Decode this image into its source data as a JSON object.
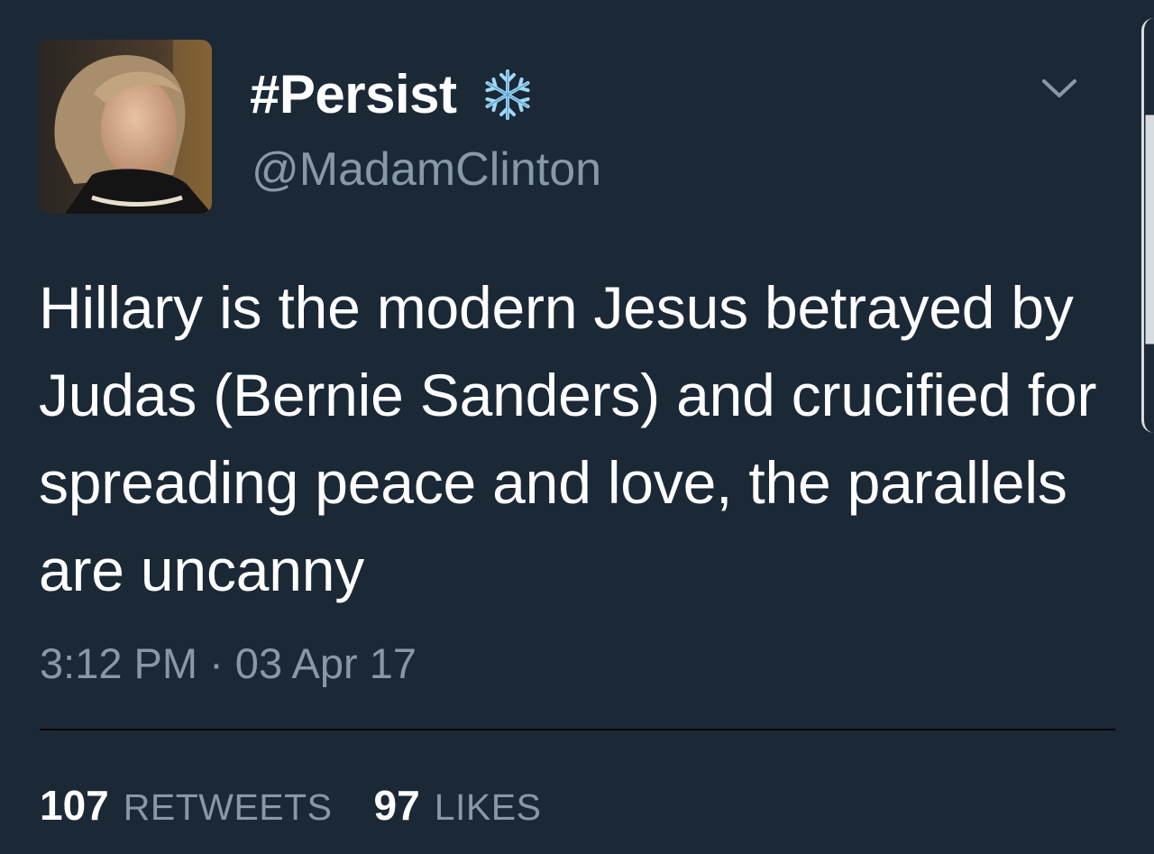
{
  "tweet": {
    "display_name": "#Persist",
    "handle": "@MadamClinton",
    "text": "Hillary is the modern Jesus betrayed by Judas (Bernie Sanders) and crucified for spreading peace and love, the parallels are uncanny",
    "timestamp": "3:12 PM · 03 Apr 17",
    "retweets_count": "107",
    "retweets_label": "RETWEETS",
    "likes_count": "97",
    "likes_label": "LIKES"
  },
  "icons": {
    "name_emoji": "snowflake-icon",
    "menu": "chevron-down-icon"
  },
  "colors": {
    "background": "#1b2836",
    "primary_text": "#ffffff",
    "secondary_text": "#8899a6",
    "snowflake": "#9fd8f5"
  }
}
